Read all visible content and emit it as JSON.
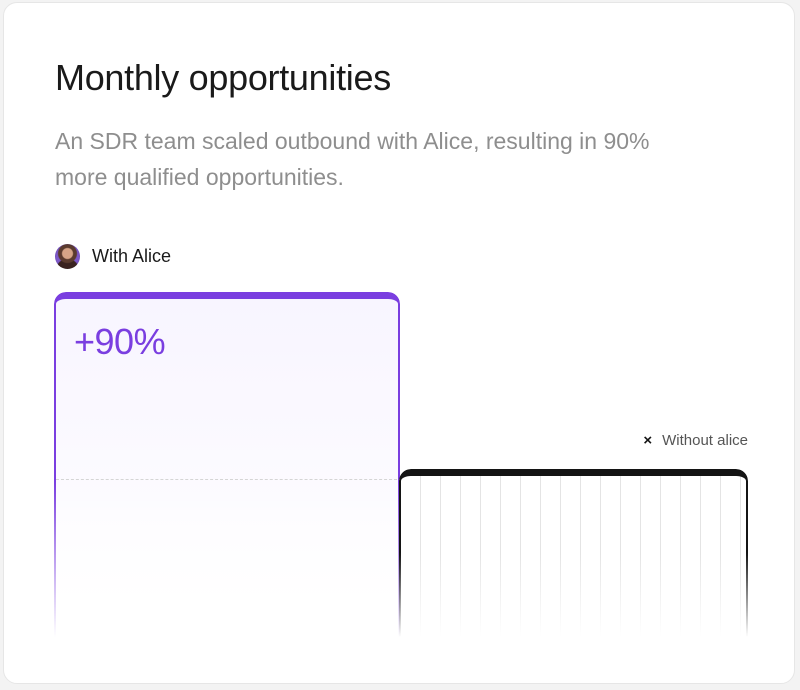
{
  "card": {
    "title": "Monthly opportunities",
    "subtitle": "An SDR team scaled outbound with Alice, resulting in 90% more qualified opportunities."
  },
  "chart_data": {
    "type": "bar",
    "title": "Monthly opportunities",
    "subtitle": "An SDR team scaled outbound with Alice, resulting in 90% more qualified opportunities.",
    "categories": [
      "With Alice",
      "Without alice"
    ],
    "values": [
      1.9,
      1.0
    ],
    "annotations": [
      "+90%"
    ],
    "legend": [
      {
        "label": "With Alice",
        "icon": "avatar",
        "color": "#7a3ee0"
      },
      {
        "label": "Without alice",
        "icon": "x-icon",
        "color": "#141414"
      }
    ],
    "grid": false,
    "reference_line": "dashed at baseline level (Without alice)"
  },
  "legend": {
    "with_label": "With Alice",
    "without_label": "Without alice",
    "without_icon": "×"
  },
  "bars": {
    "with_annotation": "+90%"
  },
  "colors": {
    "accent": "#7a3ee0",
    "dark": "#141414",
    "subtitle": "#8e8e8e"
  }
}
